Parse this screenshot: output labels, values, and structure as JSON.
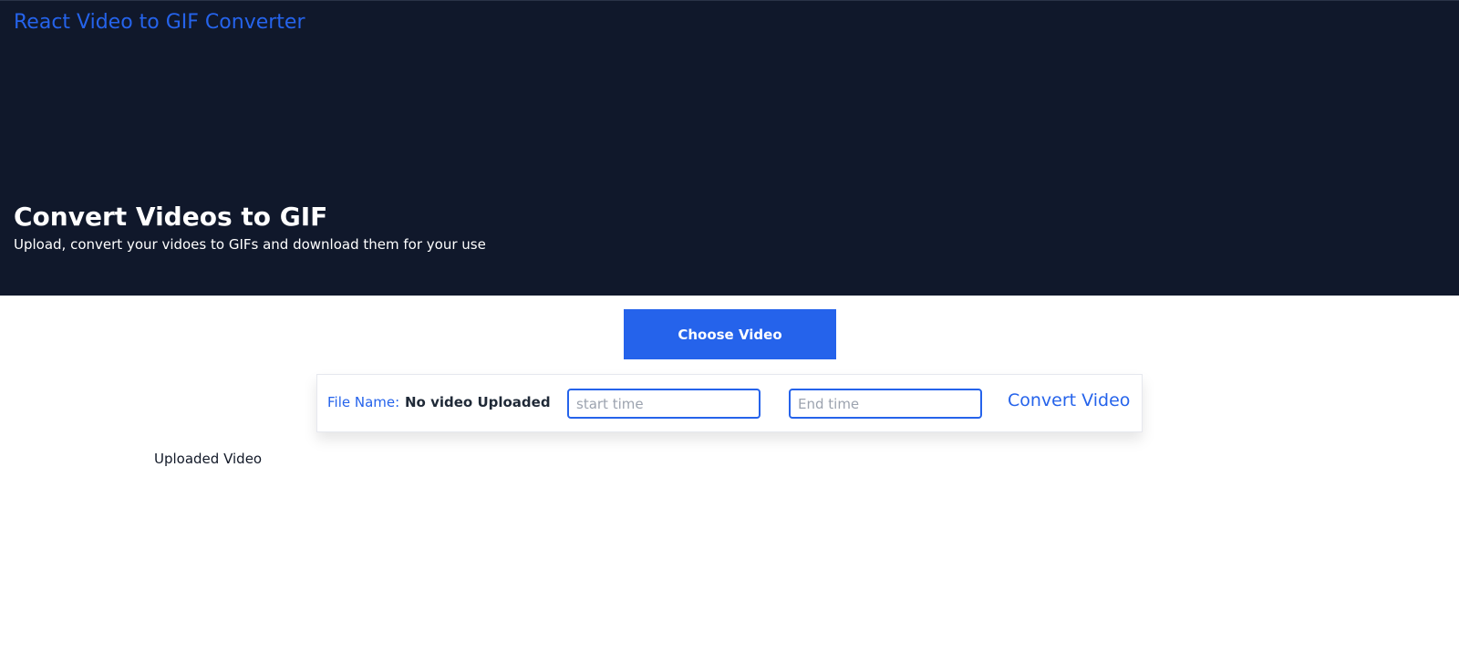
{
  "header": {
    "app_title": "React Video to GIF Converter",
    "heading": "Convert Videos to GIF",
    "subheading": "Upload, convert your vidoes to GIFs and download them for your use"
  },
  "actions": {
    "choose_label": "Choose Video"
  },
  "panel": {
    "file_label": "File Name:",
    "file_value": "No video Uploaded",
    "start_placeholder": "start time",
    "start_value": "",
    "end_placeholder": "End time",
    "end_value": "",
    "convert_label": "Convert Video"
  },
  "content": {
    "uploaded_label": "Uploaded Video"
  },
  "colors": {
    "hero_background": "#10182b",
    "accent": "#2563eb",
    "text_light": "#ffffff"
  }
}
